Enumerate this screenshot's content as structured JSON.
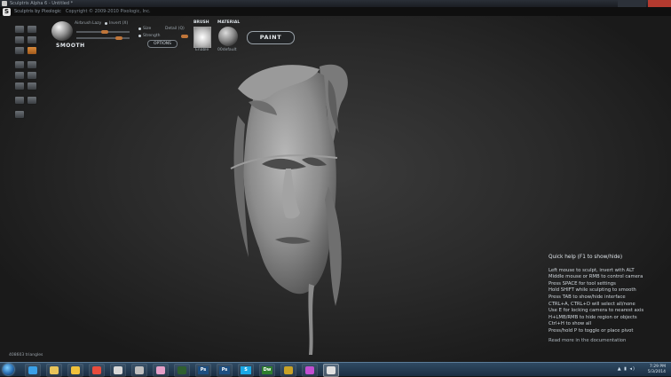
{
  "window": {
    "title": "Sculptris Alpha 6 - Untitled *"
  },
  "header": {
    "app_name": "Sculptris by Pixologic",
    "copyright": "Copyright © 2009-2010 Pixologic, Inc."
  },
  "brush_panel": {
    "tool_name": "SMOOTH",
    "airbrush_label": "Airbrush",
    "lazy_label": "Lazy",
    "invert_label": "Invert (X)",
    "size_label": "Size",
    "strength_label": "Strength",
    "detail_label": "Detail (Q)",
    "options_label": "OPTIONS"
  },
  "brush": {
    "heading": "BRUSH",
    "name": "Enable"
  },
  "material": {
    "heading": "MATERIAL",
    "name": "00default"
  },
  "paint_button": "PAINT",
  "quick_help": {
    "title": "Quick help (F1 to show/hide)",
    "lines": [
      "Left mouse to sculpt, invert with ALT",
      "Middle mouse or RMB to control camera",
      "Press SPACE for tool settings",
      "Hold SHIFT while sculpting to smooth",
      "Press TAB to show/hide interface",
      "CTRL+A, CTRL+D will select all/none",
      "Use E for locking camera to nearest axis",
      "H+LMB/RMB to hide region or objects",
      "Ctrl+H to show all",
      "Press/hold P to toggle or place pivot"
    ],
    "more": "Read more in the documentation"
  },
  "status": {
    "triangles": "408603 triangles"
  },
  "taskbar": {
    "apps": [
      {
        "name": "ie-icon",
        "color": "#3aa0e8"
      },
      {
        "name": "folder-icon",
        "color": "#e8c45a"
      },
      {
        "name": "outlook-icon",
        "color": "#f0c13b"
      },
      {
        "name": "chrome-icon",
        "color": "#e84c3d"
      },
      {
        "name": "bird-icon",
        "color": "#d8d8d8"
      },
      {
        "name": "target-icon",
        "color": "#bfbfbf"
      },
      {
        "name": "paint-icon",
        "color": "#e6a0c8"
      },
      {
        "name": "console-icon",
        "color": "#2f5f2f"
      },
      {
        "name": "photoshop-icon",
        "color": "#1d4e80",
        "text": "Ps"
      },
      {
        "name": "photoshop-icon-2",
        "color": "#1d4e80",
        "text": "Ps"
      },
      {
        "name": "skype-icon",
        "color": "#1aa8e6",
        "text": "S"
      },
      {
        "name": "dreamweaver-icon",
        "color": "#2d7d2d",
        "text": "Dw"
      },
      {
        "name": "zbrush-icon",
        "color": "#c9a227"
      },
      {
        "name": "star-icon",
        "color": "#c24fd1"
      },
      {
        "name": "sculptris-icon",
        "color": "#e0e0e0"
      }
    ],
    "time": "7:29 PM",
    "date": "5/3/2014",
    "tray_text": "▲ ▮ ◂)"
  }
}
